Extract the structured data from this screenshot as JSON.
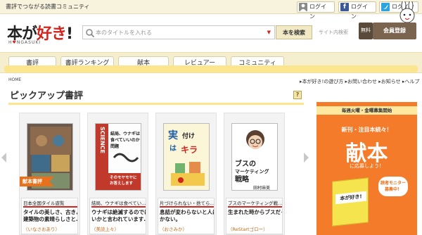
{
  "topbar": {
    "tagline": "書評でつながる読書コミュニティ",
    "login_buttons": [
      {
        "label": "ログイン",
        "icon": "user-icon",
        "color": "#8a8a8a"
      },
      {
        "label": "ログイン",
        "icon": "facebook-icon",
        "color": "#3b5998"
      },
      {
        "label": "ログイン",
        "icon": "twitter-icon",
        "color": "#2aa3e0"
      }
    ]
  },
  "header": {
    "logo_main_1": "本が",
    "logo_main_2": "好き",
    "logo_main_3": "!",
    "logo_sub_1": "H",
    "logo_sub_heart": "♥",
    "logo_sub_2": "NGASUKI",
    "search_placeholder": "本のタイトルを入れる",
    "search_button": "本を検索",
    "site_search": "サイト内検索",
    "free_badge": "無料",
    "register_button": "会員登録"
  },
  "nav": {
    "tabs": [
      "書評",
      "書評ランキング",
      "献本",
      "レビュアー",
      "コミュニティ"
    ]
  },
  "breadcrumb": "HOME",
  "sublinks": {
    "text": "▸本が好き!の遊び方 ▸お問い合わせ ▸お知らせ ▸ヘルプ"
  },
  "section": {
    "title": "ピックアップ書評",
    "help": "?"
  },
  "cards": [
    {
      "title": "日本全国タイル遊覧",
      "line1": "タイルの美しさ、古きよき",
      "line2": "建築物の素晴らしさと…",
      "author": "（いなさおあり）",
      "ribbon": "献本書評"
    },
    {
      "title": "結局、ウナギは食べてい…",
      "line1": "ウナギは絶滅するのではな",
      "line2": "いかと言われています…",
      "author": "（美読上々）",
      "cover_spine": "SCIENCE",
      "cover_text_1": "結局、ウナギは",
      "cover_text_2": "食べていいのか問題",
      "cover_text_3": "そのモヤモヤに",
      "cover_text_4": "お答えします"
    },
    {
      "title": "片づけられない・捨てら…",
      "line1": "息詰が変わらないと人は動",
      "line2": "かない。",
      "author": "（おさみか）",
      "cover_text_1": "実",
      "cover_text_2": "は",
      "cover_text_3": "付け",
      "cover_text_4": "キラ"
    },
    {
      "title": "ブスのマーケティング戦…",
      "line1": "生まれた時からブスだった",
      "line2": "",
      "author": "（ReStartゴロー）",
      "cover_text_1": "ブスの",
      "cover_text_2": "マーケティング",
      "cover_text_3": "戦略",
      "cover_text_4": "田村麻美"
    }
  ],
  "banner": {
    "top": "毎週火曜・金曜募集開始",
    "mid": "新刊・注目本続々！",
    "big": "献本",
    "sub": "に応募しよう！",
    "book_label": "本が好き!",
    "bubble_1": "読者モニター",
    "bubble_2": "募集中！"
  },
  "colors": {
    "accent_red": "#d0261e",
    "nav_yellow": "#fbe58f",
    "banner_orange": "#f47b29",
    "ribbon_orange": "#e9711c"
  }
}
